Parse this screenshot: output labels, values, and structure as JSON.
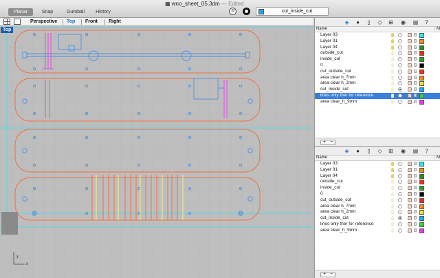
{
  "window": {
    "title": "wno_sheet_05.3dm",
    "edited": "— Edited",
    "modes": [
      "Planar",
      "Snap",
      "Gumball",
      "History"
    ],
    "current_layer": "cut_inside_cut",
    "current_layer_color": "#1ea7f0"
  },
  "viewport_tabs": [
    "Perspective",
    "Top",
    "Front",
    "Right"
  ],
  "viewport": {
    "label": "Top",
    "axis_y": "y",
    "axis_x": "x"
  },
  "colors": {
    "outline": "#f07040",
    "hole": "#4a90e0",
    "magenta": "#e040e0",
    "yellow": "#f8ec8a",
    "cyan": "#30e0f0",
    "grid": "#aaaaaa"
  },
  "layer_panel_top": {
    "header_name": "Name",
    "header_ma": "Ma",
    "layers": [
      {
        "name": "Layer 03",
        "color": "#30e8f0",
        "bulb": true,
        "active": false,
        "selected": false
      },
      {
        "name": "Layer 01",
        "color": "#f08a28",
        "bulb": true,
        "active": false,
        "selected": false
      },
      {
        "name": "Layer 04",
        "color": "#2a8a2a",
        "bulb": true,
        "active": false,
        "selected": false
      },
      {
        "name": "outside_cut",
        "color": "#e83020",
        "bulb": false,
        "active": false,
        "selected": false
      },
      {
        "name": "inside_cut",
        "color": "#2aa02a",
        "bulb": false,
        "active": false,
        "selected": false
      },
      {
        "name": "0",
        "color": "#000000",
        "bulb": false,
        "active": false,
        "selected": false
      },
      {
        "name": "cut_outside_cut",
        "color": "#e83020",
        "bulb": false,
        "active": false,
        "selected": false
      },
      {
        "name": "area clear h_7mm",
        "color": "#f08a28",
        "bulb": false,
        "active": false,
        "selected": false
      },
      {
        "name": "area clear h_2mm",
        "color": "#f0e040",
        "bulb": false,
        "active": false,
        "selected": false
      },
      {
        "name": "cut_inside_cut",
        "color": "#1ea7f0",
        "bulb": false,
        "active": true,
        "selected": false
      },
      {
        "name": "lines only ther for reference",
        "color": "#40d040",
        "bulb": false,
        "active": false,
        "selected": true
      },
      {
        "name": "area clear_h_9mm",
        "color": "#e040e0",
        "bulb": false,
        "active": false,
        "selected": false
      }
    ]
  },
  "layer_panel_bottom": {
    "header_name": "Name",
    "header_ma": "Ma",
    "layers": [
      {
        "name": "Layer 03",
        "color": "#30e8f0",
        "bulb": true,
        "active": false,
        "selected": false
      },
      {
        "name": "Layer 01",
        "color": "#f08a28",
        "bulb": true,
        "active": false,
        "selected": false
      },
      {
        "name": "Layer 04",
        "color": "#2a8a2a",
        "bulb": true,
        "active": false,
        "selected": false
      },
      {
        "name": "outside_cut",
        "color": "#e83020",
        "bulb": false,
        "active": false,
        "selected": false
      },
      {
        "name": "inside_cut",
        "color": "#2aa02a",
        "bulb": false,
        "active": false,
        "selected": false
      },
      {
        "name": "0",
        "color": "#000000",
        "bulb": false,
        "active": false,
        "selected": false
      },
      {
        "name": "cut_outside_cut",
        "color": "#e83020",
        "bulb": false,
        "active": false,
        "selected": false
      },
      {
        "name": "area clear h_7mm",
        "color": "#f08a28",
        "bulb": false,
        "active": false,
        "selected": false
      },
      {
        "name": "area clear h_2mm",
        "color": "#f0e040",
        "bulb": false,
        "active": false,
        "selected": false
      },
      {
        "name": "cut_inside_cut",
        "color": "#1ea7f0",
        "bulb": false,
        "active": true,
        "selected": false
      },
      {
        "name": "lines only ther for reference",
        "color": "#40d040",
        "bulb": false,
        "active": false,
        "selected": false
      },
      {
        "name": "area clear_h_9mm",
        "color": "#e040e0",
        "bulb": false,
        "active": false,
        "selected": false
      }
    ]
  },
  "panel_footer": {
    "add": "+",
    "remove": "−"
  },
  "panel_tool_icons": [
    "layers-icon",
    "materials-icon",
    "document-icon",
    "object-icon",
    "display-icon",
    "view-icon",
    "notes-icon",
    "help-icon"
  ]
}
